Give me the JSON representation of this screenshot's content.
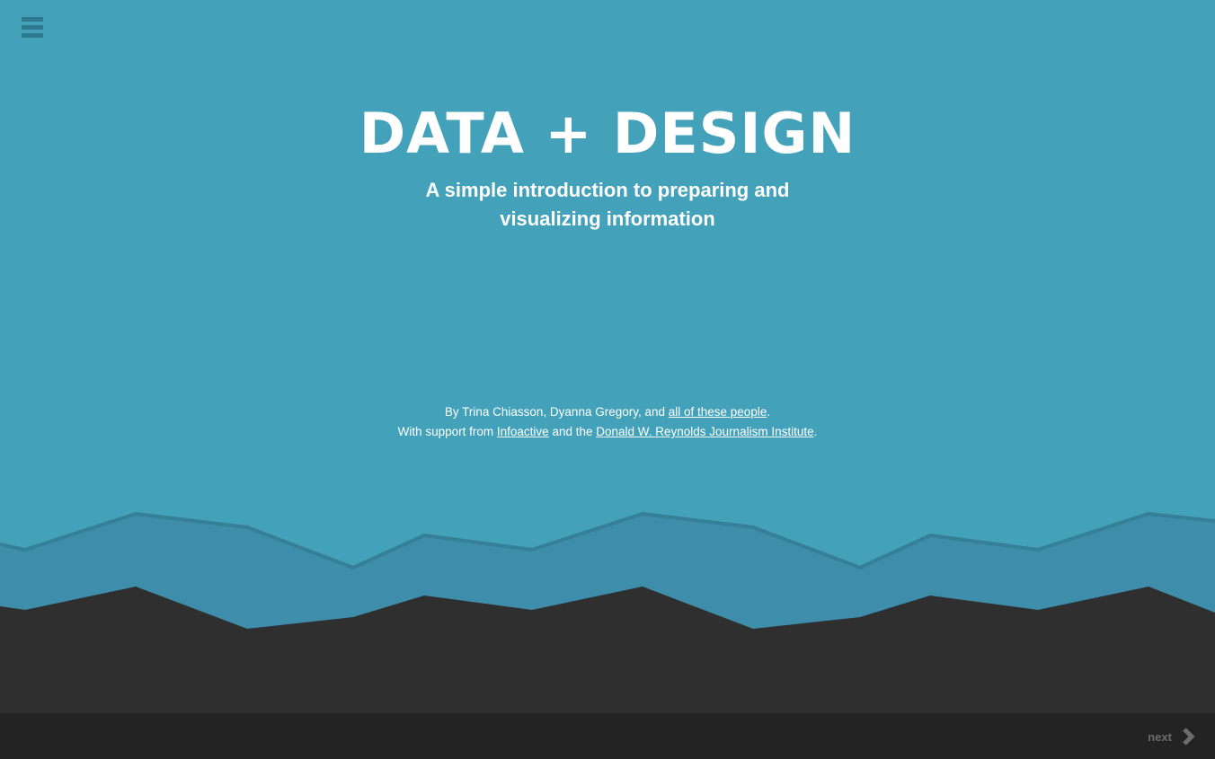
{
  "menu": {
    "icon": "hamburger-menu-icon"
  },
  "hero": {
    "title": "DATA + DESIGN",
    "subtitle": "A simple introduction to preparing and visualizing information"
  },
  "credits": {
    "line1_prefix": "By Trina Chiasson, Dyanna Gregory, and ",
    "line1_link": "all of these people",
    "line1_suffix": ".",
    "line2_prefix": "With support from ",
    "line2_link1": "Infoactive",
    "line2_middle": " and the ",
    "line2_link2": "Donald W. Reynolds Journalism Institute",
    "line2_suffix": "."
  },
  "footer": {
    "next_label": "next",
    "next_icon": "chevron-right-icon"
  },
  "colors": {
    "background": "#43a2ba",
    "mid_layer": "#3e8dab",
    "ridge_line": "#367f98",
    "dark_layer": "#2f2f2f",
    "footer": "#232323",
    "next_text": "#6c6c6c",
    "menu_icon": "#2f7990"
  }
}
